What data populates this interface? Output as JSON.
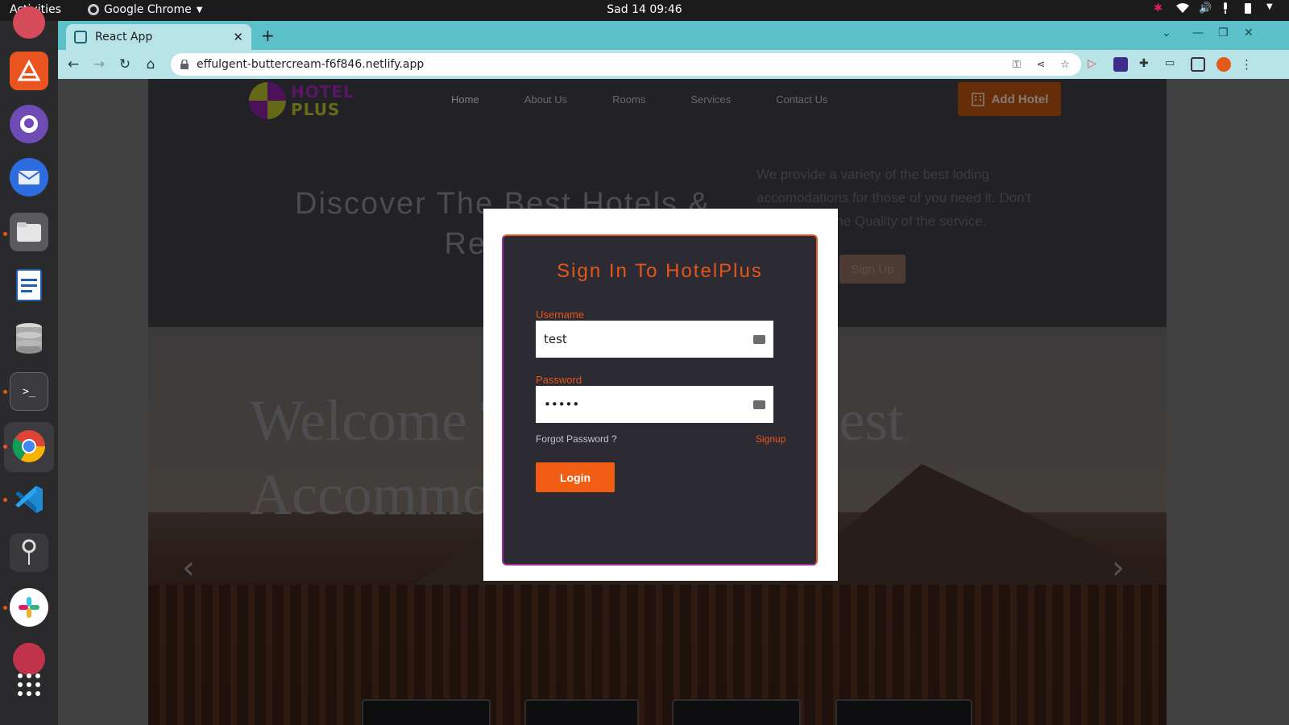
{
  "topbar": {
    "activities": "Activities",
    "app_name": "Google Chrome",
    "clock": "Sad 14  09:46"
  },
  "browser": {
    "tab_title": "React App",
    "url": "effulgent-buttercream-f6f846.netlify.app",
    "theme_color": "#5bc0c8"
  },
  "site": {
    "logo_line1": "HOTEL",
    "logo_line2": "PLUS",
    "nav": [
      "Home",
      "About Us",
      "Rooms",
      "Services",
      "Contact Us"
    ],
    "add_hotel_label": "Add Hotel",
    "hero_title": "Discover The Best Hotels & Resorts",
    "hero_desc": "We provide a variety of the best loding accomodations for those of you need it. Don't worry about the Quality of the service.",
    "signup_button": "Sign Up",
    "welcome_text": "Welcome To Stay With Best Accommodations"
  },
  "login": {
    "title": "Sign In To HotelPlus",
    "username_label": "Username",
    "username_value": "test",
    "password_label": "Password",
    "password_value": "•••••",
    "forgot_label": "Forgot Password ?",
    "signup_label": "Signup",
    "login_label": "Login",
    "accent": "#f25d14"
  }
}
